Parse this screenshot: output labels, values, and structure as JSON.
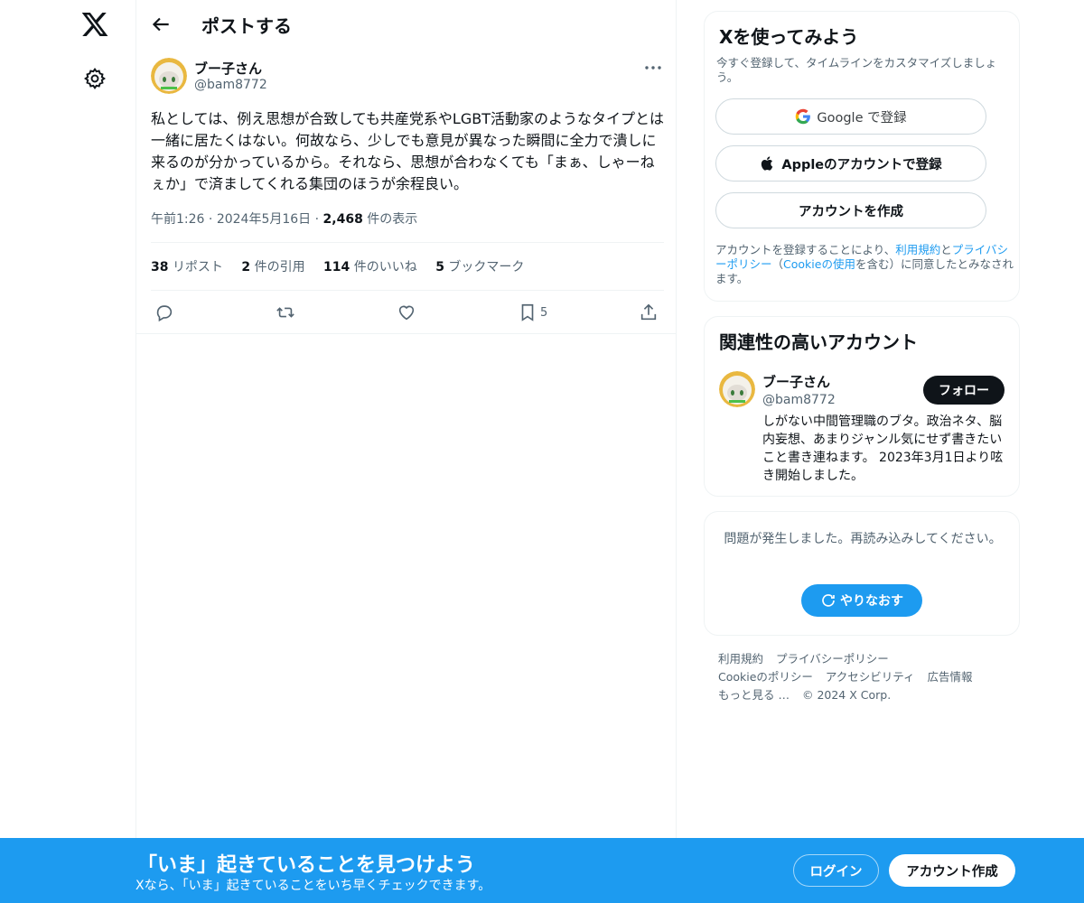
{
  "nav": {
    "logo_icon": "x-logo-icon",
    "settings_icon": "gear-icon"
  },
  "header": {
    "title": "ポストする"
  },
  "post": {
    "author_name": "ブー子さん",
    "author_handle": "@bam8772",
    "text": "私としては、例え思想が合致しても共産党系やLGBT活動家のようなタイプとは一緒に居たくはない。何故なら、少しでも意見が異なった瞬間に全力で潰しに来るのが分かっているから。それなら、思想が合わなくても「まぁ、しゃーねぇか」で済ましてくれる集団のほうが余程良い。",
    "time": "午前1:26",
    "date": "2024年5月16日",
    "views_count": "2,468",
    "views_label": "件の表示",
    "stats": {
      "reposts_count": "38",
      "reposts_label": "リポスト",
      "quotes_count": "2",
      "quotes_label": "件の引用",
      "likes_count": "114",
      "likes_label": "件のいいね",
      "bookmarks_count": "5",
      "bookmarks_label": "ブックマーク"
    },
    "bookmark_action_count": "5"
  },
  "signup": {
    "title": "Xを使ってみよう",
    "subtitle": "今すぐ登録して、タイムラインをカスタマイズしましょう。",
    "google_label": "Google で登録",
    "apple_label": "Appleのアカウントで登録",
    "create_label": "アカウントを作成",
    "legal_prefix": "アカウントを登録することにより、",
    "legal_terms": "利用規約",
    "legal_and": "と",
    "legal_privacy": "プライバシーポリシー",
    "legal_open": "（",
    "legal_cookie": "Cookieの使用",
    "legal_suffix": "を含む）に同意したとみなされます。"
  },
  "related": {
    "title": "関連性の高いアカウント",
    "name": "ブー子さん",
    "handle": "@bam8772",
    "follow_label": "フォロー",
    "bio": "しがない中間管理職のブタ。政治ネタ、脳内妄想、あまりジャンル気にせず書きたいこと書き連ねます。 2023年3月1日より呟き開始しました。"
  },
  "error": {
    "message": "問題が発生しました。再読み込みしてください。",
    "retry_label": "やりなおす"
  },
  "footer": {
    "terms": "利用規約",
    "privacy": "プライバシーポリシー",
    "cookie": "Cookieのポリシー",
    "accessibility": "アクセシビリティ",
    "ads": "広告情報",
    "more": "もっと見る …",
    "copyright": "© 2024 X Corp."
  },
  "bottom_bar": {
    "title": "「いま」起きていることを見つけよう",
    "subtitle": "Xなら、「いま」起きていることをいち早くチェックできます。",
    "login_label": "ログイン",
    "signup_label": "アカウント作成"
  },
  "colors": {
    "accent": "#1d9bf0",
    "text": "#0f1419",
    "secondary": "#536471"
  }
}
